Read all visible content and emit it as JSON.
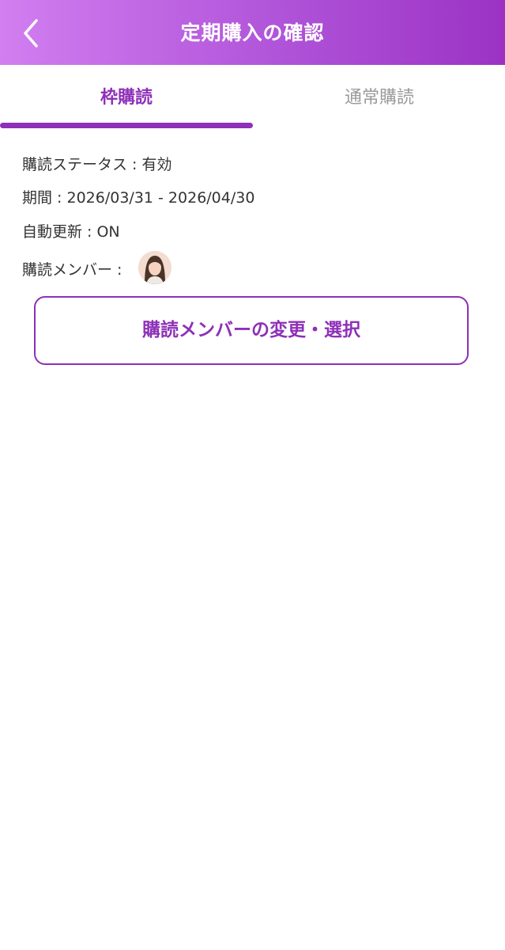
{
  "header": {
    "title": "定期購入の確認",
    "back_icon": "chevron-left-icon"
  },
  "tabs": [
    {
      "label": "枠購読",
      "active": true
    },
    {
      "label": "通常購読",
      "active": false
    }
  ],
  "subscription": {
    "status_line": "購読ステータス : 有効",
    "period_line": "期間 : 2026/03/31 - 2026/04/30",
    "auto_renew_line": "自動更新 : ON",
    "members_label": "購読メンバー :"
  },
  "change_button_label": "購読メンバーの変更・選択",
  "colors": {
    "accent": "#8e30b8",
    "header_gradient_start": "#d27ef0",
    "header_gradient_end": "#9b32c4",
    "inactive_tab_text": "#9a9a9a"
  }
}
